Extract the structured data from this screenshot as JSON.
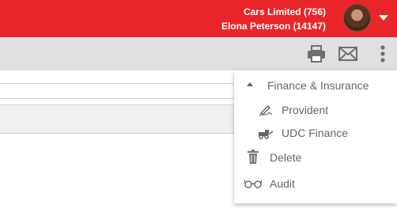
{
  "header": {
    "company": "Cars Limited (756)",
    "user": "Elona Peterson (14147)",
    "color": "#e8262a"
  },
  "toolbar": {
    "icons": [
      "printer-icon",
      "mail-icon",
      "more-vertical-icon"
    ]
  },
  "menu": {
    "group_label": "Finance & Insurance",
    "items": [
      {
        "label": "Provident",
        "icon": "signature-icon"
      },
      {
        "label": "UDC Finance",
        "icon": "tow-truck-icon"
      },
      {
        "label": "Delete",
        "icon": "trash-icon"
      },
      {
        "label": "Audit",
        "icon": "glasses-icon"
      }
    ]
  }
}
